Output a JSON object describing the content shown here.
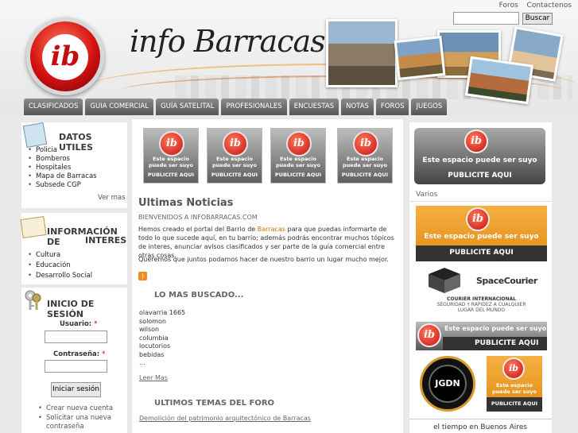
{
  "header": {
    "brand": "info Barracas",
    "logo_letters": "ib",
    "toplinks": [
      "Foros",
      "Contactenos"
    ],
    "search_button": "Buscar"
  },
  "nav": [
    "CLASIFICADOS",
    "GUIA COMERCIAL",
    "GUÍA SATELITAL",
    "PROFESIONALES",
    "ENCUESTAS",
    "NOTAS",
    "FOROS",
    "JUEGOS"
  ],
  "datos_utiles": {
    "title": "DATOS UTILES",
    "items": [
      "Policia",
      "Bomberos",
      "Hospitales",
      "Mapa de Barracas",
      "Subsede CGP"
    ],
    "more": "Ver mas"
  },
  "info_interes": {
    "title_line1": "INFORMACIÓN DE",
    "title_line2": "INTERES",
    "items": [
      "Cultura",
      "Educación",
      "Desarrollo Social"
    ]
  },
  "login": {
    "title": "INICIO DE SESIÓN",
    "user_label": "Usuario:",
    "pass_label": "Contraseña:",
    "required": "*",
    "button": "Iniciar sesión",
    "links": [
      "Crear nueva cuenta",
      "Solicitar una nueva",
      "contraseña"
    ]
  },
  "ads": {
    "letters": "ib",
    "line1": "Este espacio",
    "line1b": "puede ser suyo",
    "line2": "PUBLICITE AQUI",
    "big_line1": "Este espacio puede ser suyo",
    "big_line2": "PUBLICITE AQUI"
  },
  "news": {
    "title": "Ultimas Noticias",
    "subtitle": "BIENVENIDOS A INFOBARRACAS.COM",
    "p1a": "Hemos creado el portal del Barrio de ",
    "p1link": "Barracas",
    "p1b": " para que puedas informarte de todo lo que sucede aquí, en tu barrio; además podrás encontrar muchos tópicos de interes, anunciar avisos clasificados y ser parte de la guía comercial entre otras cosas.",
    "p2": "Queremos que juntos podamos hacer de nuestro barrio un lugar mucho mejor."
  },
  "mas_buscado": {
    "title": "LO MAS BUSCADO...",
    "items": [
      "olavarria 1665",
      "solomon",
      "wilson",
      "columbia",
      "locutorios",
      "bebidas",
      "..."
    ],
    "more": "Leer Mas"
  },
  "foro": {
    "title": "ULTIMOS TEMAS DEL FORO",
    "link": "Demolición del patrimonio arquitectónico de Barracas"
  },
  "right": {
    "varios": "Varios",
    "spacecourier": "SpaceCourier",
    "spacecourier_tag1": "COURIER INTERNACIONAL",
    "spacecourier_tag2": "SEGURIDAD Y RAPIDEZ A CUALQUIER",
    "spacecourier_tag3": "LUGAR DEL MUNDO",
    "jgdn": "JGDN",
    "tiempo": "el tiempo en Buenos Aires"
  }
}
